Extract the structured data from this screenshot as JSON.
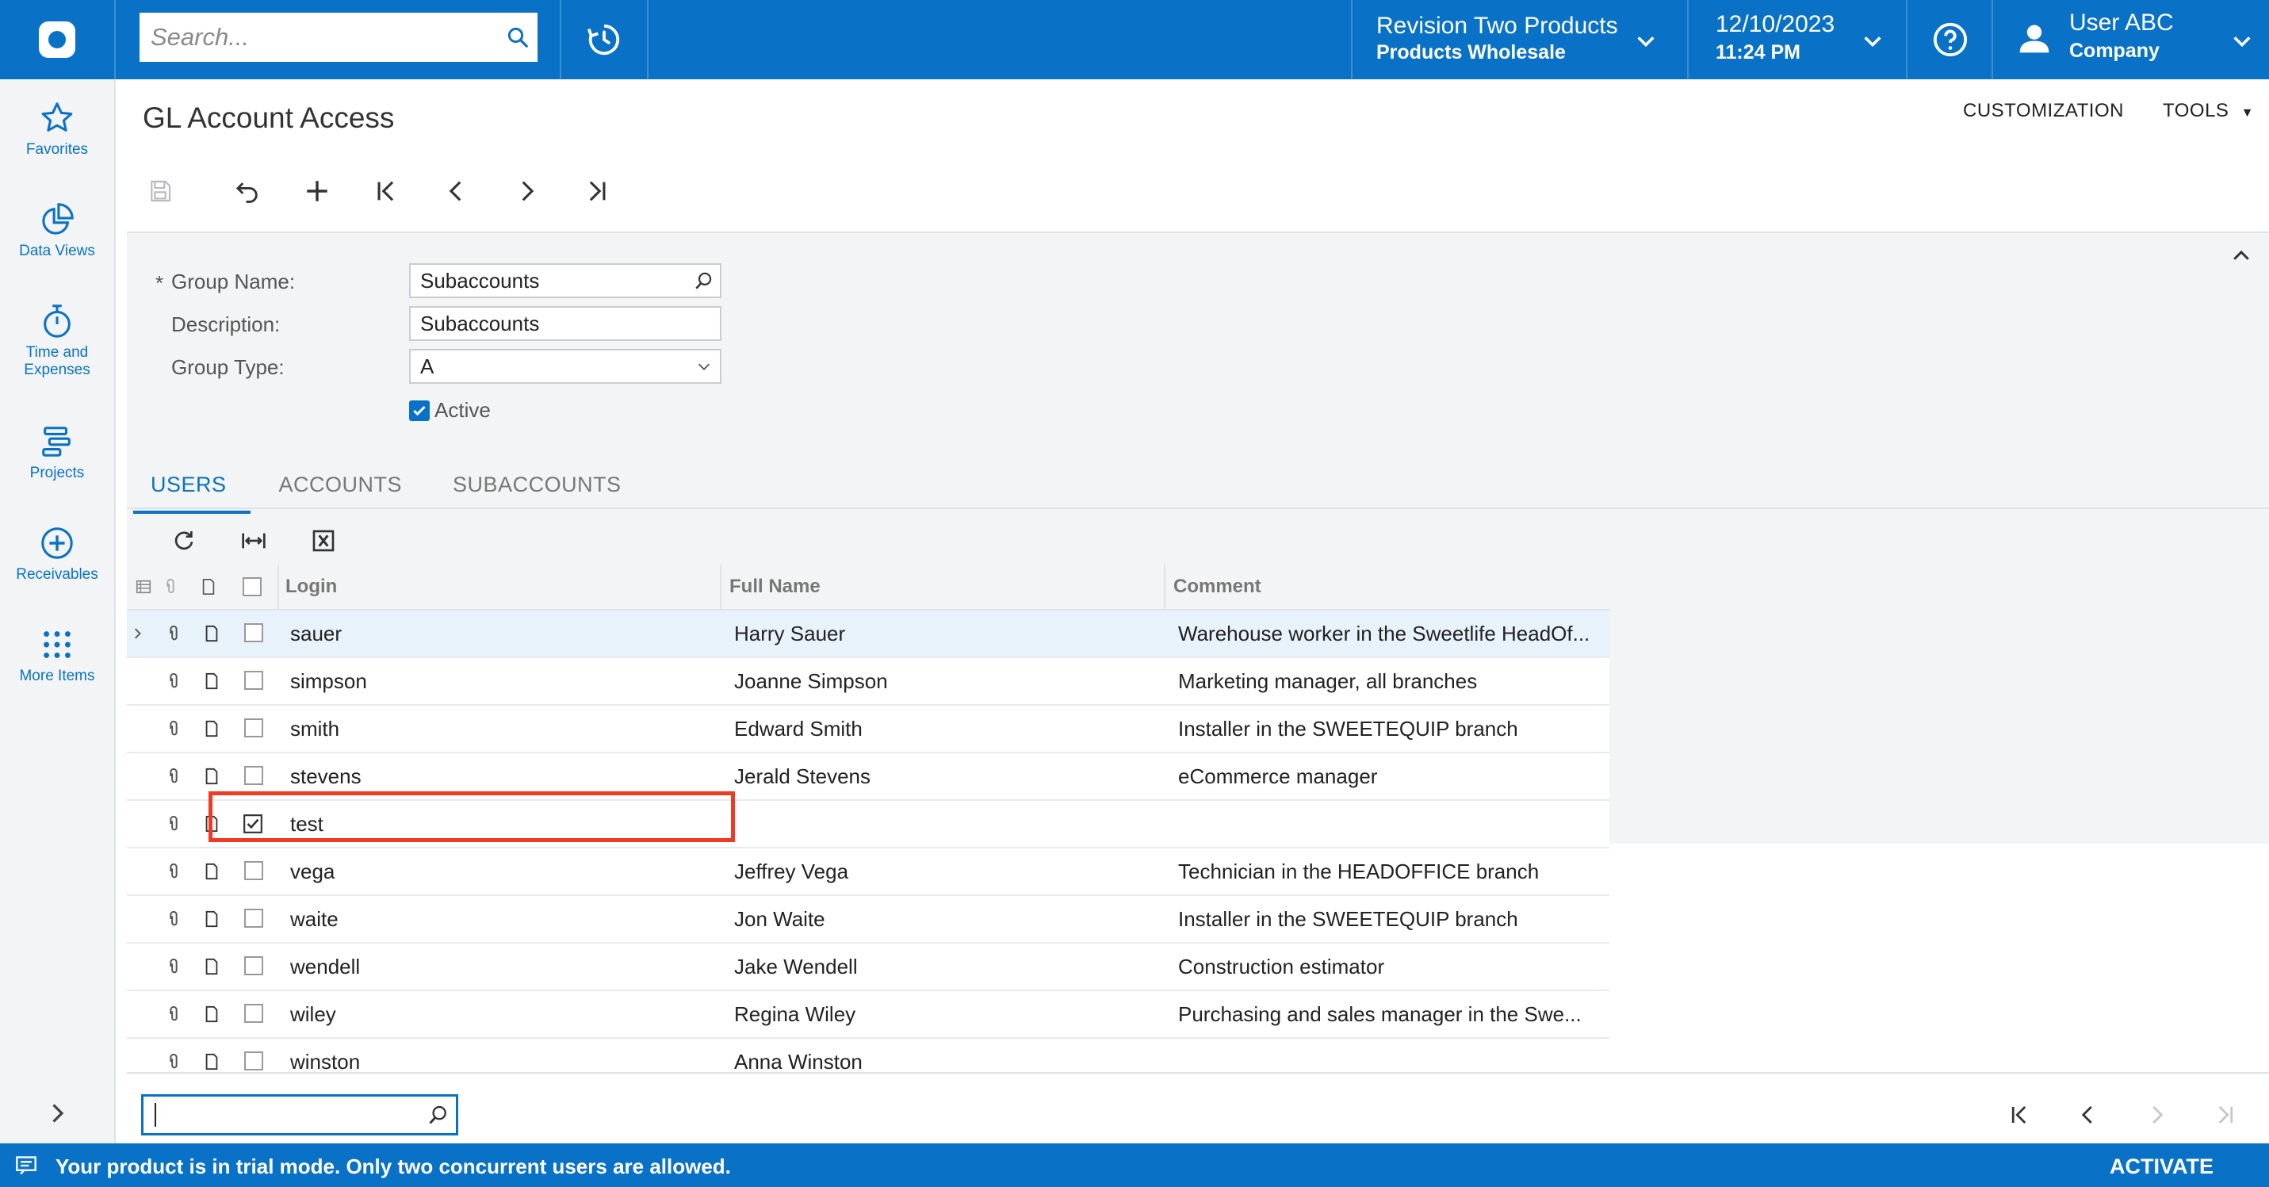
{
  "topbar": {
    "search_placeholder": "Search...",
    "tenant_name": "Revision Two Products",
    "tenant_branch": "Products Wholesale",
    "date": "12/10/2023",
    "time": "11:24 PM",
    "user_name": "User ABC",
    "user_company": "Company",
    "brand_color": "#0a72c6"
  },
  "leftnav": {
    "items": [
      {
        "label": "Favorites",
        "icon": "star-icon"
      },
      {
        "label": "Data Views",
        "icon": "pie-chart-icon"
      },
      {
        "label": "Time and Expenses",
        "icon": "stopwatch-icon"
      },
      {
        "label": "Projects",
        "icon": "projects-icon"
      },
      {
        "label": "Receivables",
        "icon": "plus-circle-icon"
      },
      {
        "label": "More Items",
        "icon": "grid-dots-icon"
      }
    ]
  },
  "page": {
    "title": "GL Account Access",
    "customization_label": "CUSTOMIZATION",
    "tools_label": "TOOLS"
  },
  "form": {
    "group_name_label": "Group Name:",
    "group_name_value": "Subaccounts",
    "description_label": "Description:",
    "description_value": "Subaccounts",
    "group_type_label": "Group Type:",
    "group_type_value": "A",
    "active_label": "Active",
    "active_checked": true
  },
  "tabs": [
    "USERS",
    "ACCOUNTS",
    "SUBACCOUNTS"
  ],
  "grid": {
    "columns": {
      "login": "Login",
      "full_name": "Full Name",
      "comment": "Comment"
    },
    "rows": [
      {
        "login": "sauer",
        "full_name": "Harry Sauer",
        "comment": "Warehouse worker in the Sweetlife HeadOf...",
        "checked": false,
        "selected": true
      },
      {
        "login": "simpson",
        "full_name": "Joanne Simpson",
        "comment": "Marketing manager, all branches",
        "checked": false,
        "selected": false
      },
      {
        "login": "smith",
        "full_name": "Edward Smith",
        "comment": "Installer in the SWEETEQUIP branch",
        "checked": false,
        "selected": false
      },
      {
        "login": "stevens",
        "full_name": "Jerald Stevens",
        "comment": "eCommerce manager",
        "checked": false,
        "selected": false
      },
      {
        "login": "test",
        "full_name": "",
        "comment": "",
        "checked": true,
        "selected": false
      },
      {
        "login": "vega",
        "full_name": "Jeffrey Vega",
        "comment": "Technician in the HEADOFFICE branch",
        "checked": false,
        "selected": false
      },
      {
        "login": "waite",
        "full_name": "Jon Waite",
        "comment": "Installer in the SWEETEQUIP branch",
        "checked": false,
        "selected": false
      },
      {
        "login": "wendell",
        "full_name": "Jake Wendell",
        "comment": "Construction estimator",
        "checked": false,
        "selected": false
      },
      {
        "login": "wiley",
        "full_name": "Regina Wiley",
        "comment": "Purchasing and sales manager in the Swe...",
        "checked": false,
        "selected": false
      },
      {
        "login": "winston",
        "full_name": "Anna Winston",
        "comment": "",
        "checked": false,
        "selected": false
      }
    ]
  },
  "trial": {
    "message": "Your product is in trial mode. Only two concurrent users are allowed.",
    "activate_label": "ACTIVATE"
  }
}
